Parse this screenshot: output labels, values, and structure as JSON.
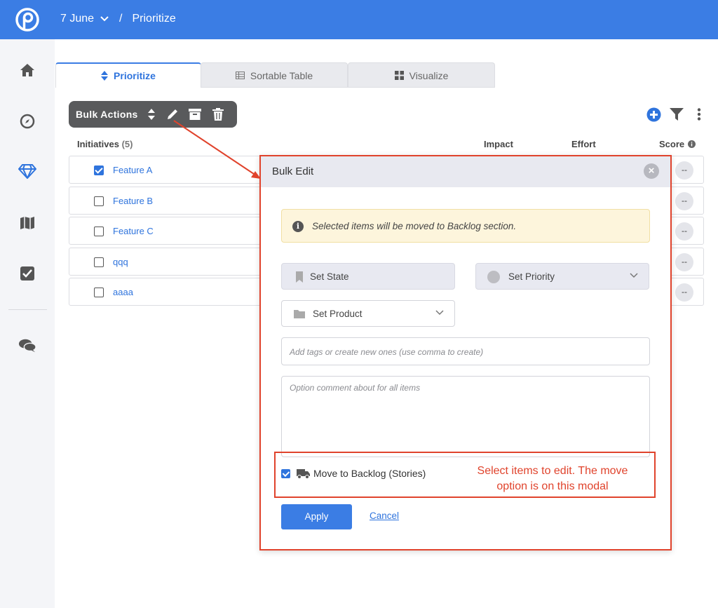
{
  "header": {
    "date": "7 June",
    "separator": "/",
    "page": "Prioritize"
  },
  "sidebar": {
    "items": [
      "home-icon",
      "compass-icon",
      "diamond-icon",
      "map-icon",
      "checkbox-icon",
      "chat-icon"
    ]
  },
  "tabs": [
    {
      "label": "Prioritize",
      "icon": "sort-icon",
      "active": true
    },
    {
      "label": "Sortable Table",
      "icon": "table-icon",
      "active": false
    },
    {
      "label": "Visualize",
      "icon": "grid-icon",
      "active": false
    }
  ],
  "bulk_actions": {
    "label": "Bulk Actions"
  },
  "table": {
    "initiatives_label": "Initiatives",
    "count": "(5)",
    "impact_label": "Impact",
    "effort_label": "Effort",
    "score_label": "Score",
    "rows": [
      {
        "name": "Feature A",
        "checked": true,
        "score": "--"
      },
      {
        "name": "Feature B",
        "checked": false,
        "score": "--"
      },
      {
        "name": "Feature C",
        "checked": false,
        "score": "--"
      },
      {
        "name": "qqq",
        "checked": false,
        "score": "--"
      },
      {
        "name": "aaaa",
        "checked": false,
        "score": "--"
      }
    ]
  },
  "modal": {
    "title": "Bulk Edit",
    "close": "×",
    "notice": "Selected items will be moved to Backlog section.",
    "set_state": "Set State",
    "set_priority": "Set Priority",
    "set_product": "Set Product",
    "tags_placeholder": "Add tags or create new ones (use comma to create)",
    "comment_placeholder": "Option comment about for all items",
    "move_label": "Move to Backlog (Stories)",
    "move_checked": true,
    "annotation_line1": "Select items to edit.  The move",
    "annotation_line2": "option is on this modal",
    "apply_label": "Apply",
    "cancel_label": "Cancel"
  },
  "colors": {
    "brand": "#3b7de4",
    "annotation": "#e0432c",
    "notice_bg": "#fdf5dc"
  }
}
